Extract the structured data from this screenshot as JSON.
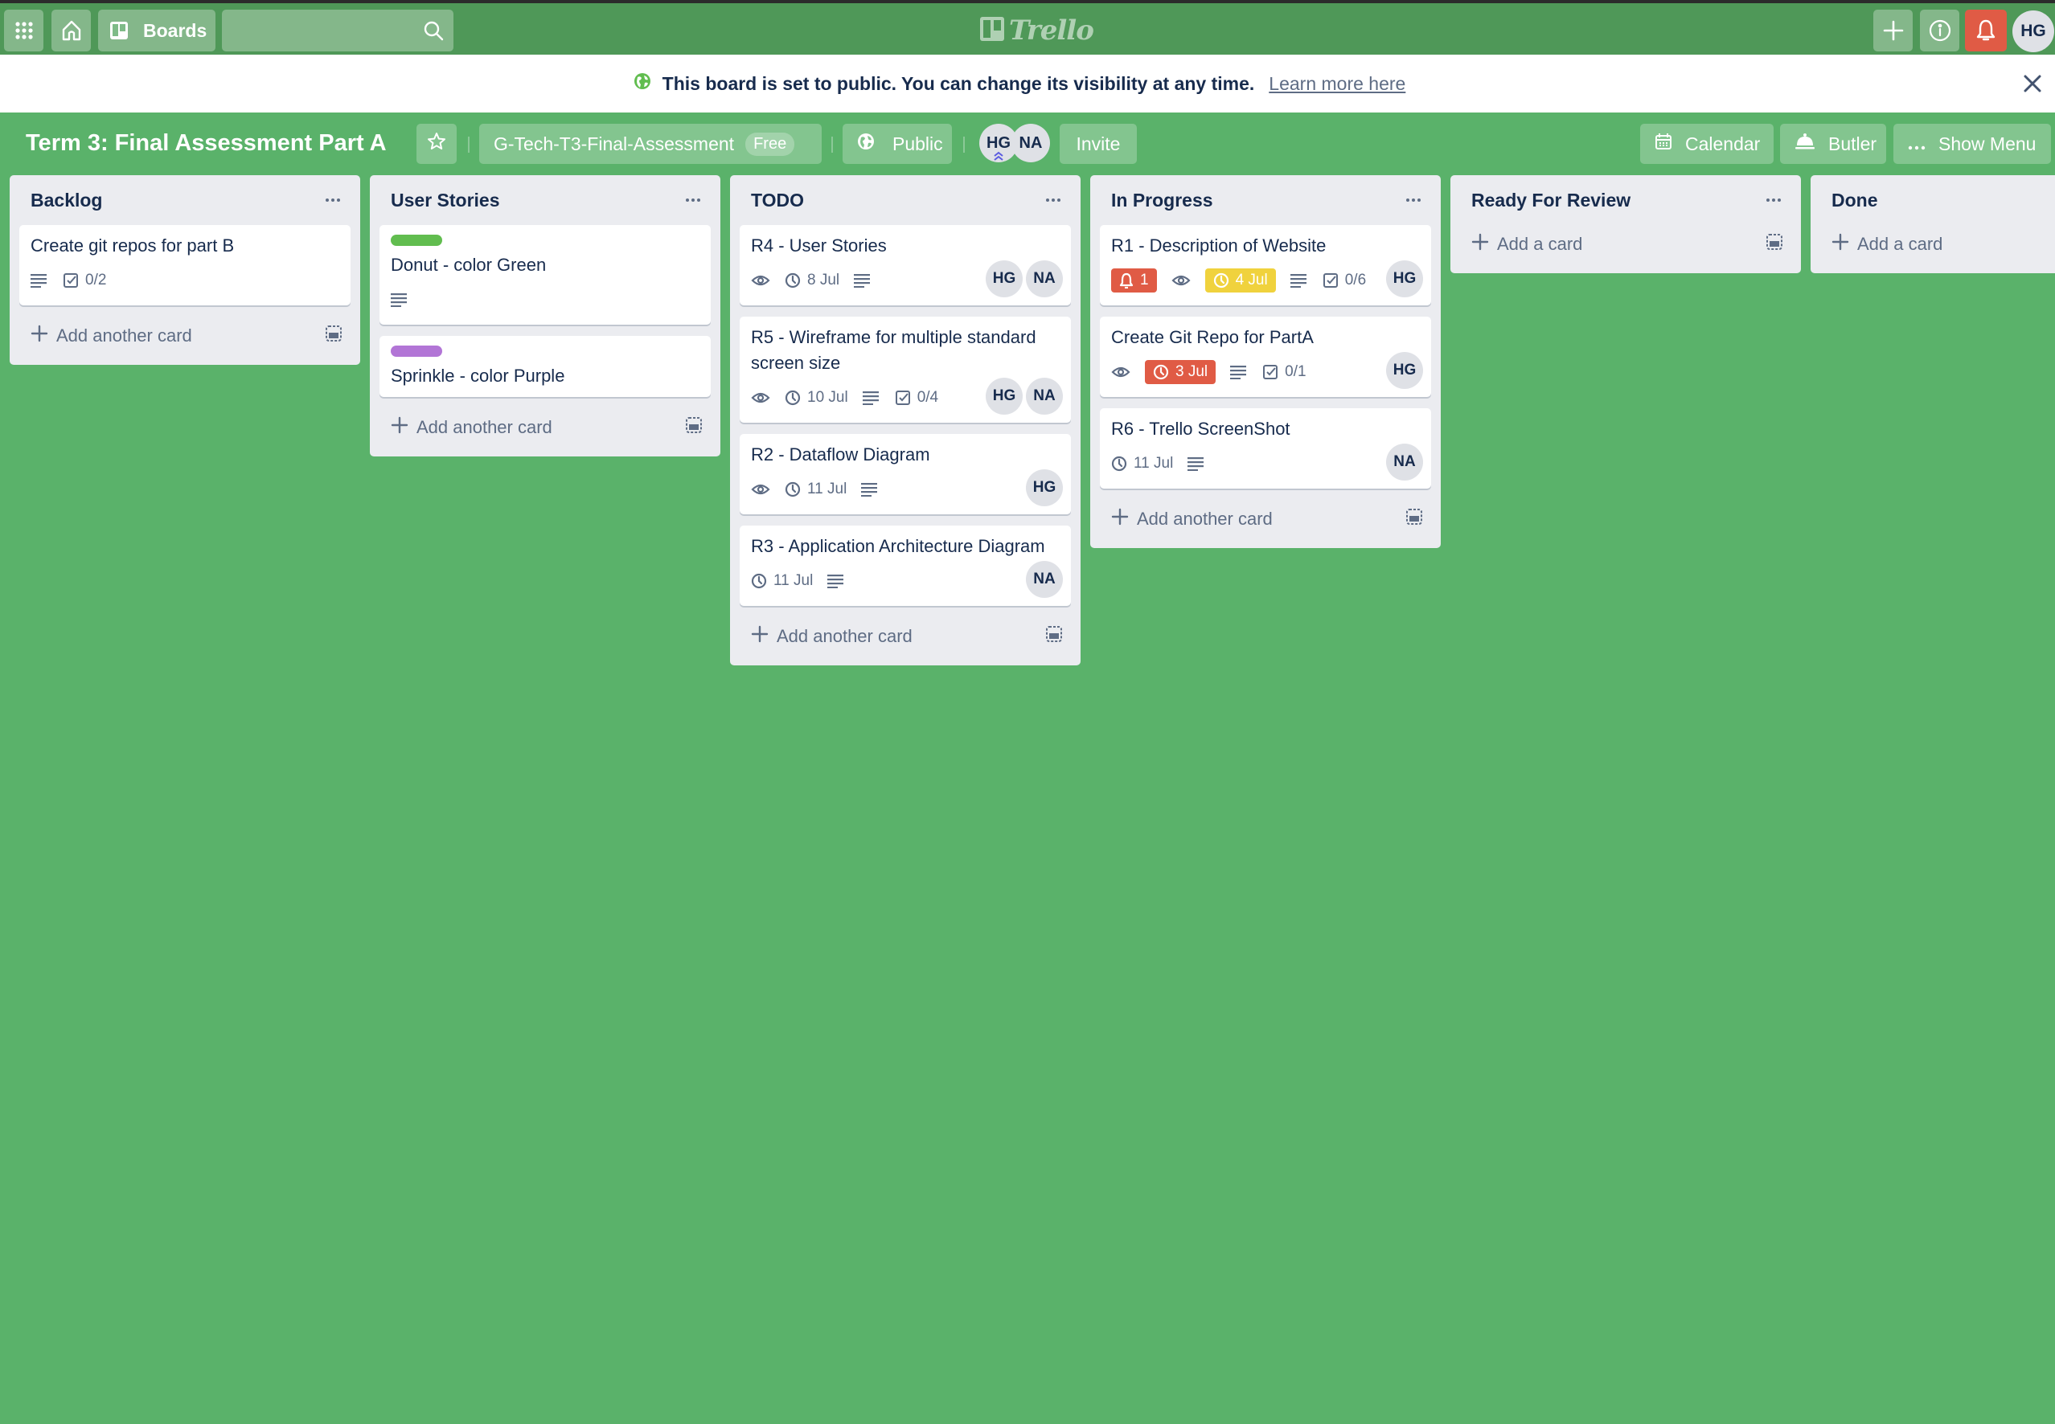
{
  "topbar": {
    "boards_label": "Boards",
    "search_value": "",
    "search_placeholder": "",
    "logo_text": "Trello",
    "user_initials": "HG",
    "colors": {
      "bar": "#4f9858",
      "notification": "#e05b45"
    }
  },
  "banner": {
    "text": "This board is set to public. You can change its visibility at any time.",
    "link": "Learn more here"
  },
  "board": {
    "title": "Term 3: Final Assessment Part A",
    "team": "G-Tech-T3-Final-Assessment",
    "team_badge": "Free",
    "visibility": "Public",
    "members": [
      "HG",
      "NA"
    ],
    "invite_label": "Invite",
    "calendar_label": "Calendar",
    "butler_label": "Butler",
    "menu_label": "Show Menu",
    "background_color": "#5ab26a"
  },
  "lists": [
    {
      "title": "Backlog",
      "cards": [
        {
          "title": "Create git repos for part B",
          "description": true,
          "checklist": "0/2",
          "members": []
        }
      ],
      "add_label": "Add another card"
    },
    {
      "title": "User Stories",
      "cards": [
        {
          "title": "Donut - color Green",
          "label_color": "#61bd4f",
          "description": true,
          "members": []
        },
        {
          "title": "Sprinkle - color Purple",
          "label_color": "#b275d6",
          "members": []
        }
      ],
      "add_label": "Add another card"
    },
    {
      "title": "TODO",
      "cards": [
        {
          "title": "R4 - User Stories",
          "watching": true,
          "due": "8 Jul",
          "description": true,
          "members": [
            "HG",
            "NA"
          ]
        },
        {
          "title": "R5 - Wireframe for multiple standard screen size",
          "watching": true,
          "due": "10 Jul",
          "description": true,
          "checklist": "0/4",
          "members": [
            "HG",
            "NA"
          ]
        },
        {
          "title": "R2 - Dataflow Diagram",
          "watching": true,
          "due": "11 Jul",
          "description": true,
          "members": [
            "HG"
          ]
        },
        {
          "title": "R3 - Application Architecture Diagram",
          "due": "11 Jul",
          "description": true,
          "members": [
            "NA"
          ]
        }
      ],
      "add_label": "Add another card"
    },
    {
      "title": "In Progress",
      "cards": [
        {
          "title": "R1 - Description of Website",
          "notifications": "1",
          "watching": true,
          "due": "4 Jul",
          "due_status": "soon",
          "description": true,
          "checklist": "0/6",
          "members": [
            "HG"
          ]
        },
        {
          "title": "Create Git Repo for PartA",
          "watching": true,
          "due": "3 Jul",
          "due_status": "overdue",
          "description": true,
          "checklist": "0/1",
          "members": [
            "HG"
          ]
        },
        {
          "title": "R6 - Trello ScreenShot",
          "due": "11 Jul",
          "description": true,
          "members": [
            "NA"
          ]
        }
      ],
      "add_label": "Add another card"
    },
    {
      "title": "Ready For Review",
      "cards": [],
      "add_label": "Add a card"
    },
    {
      "title": "Done",
      "cards": [],
      "add_label": "Add a card"
    }
  ]
}
